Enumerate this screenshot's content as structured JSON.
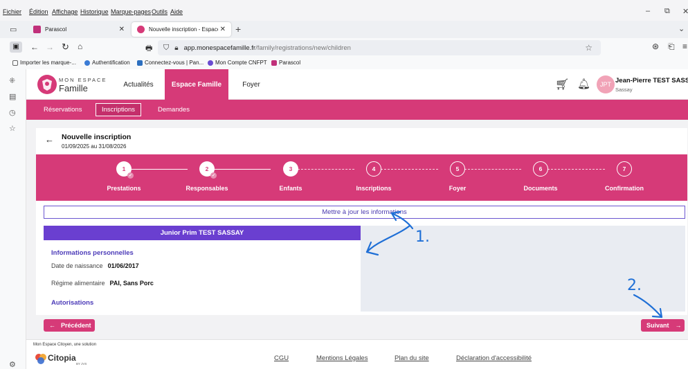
{
  "browser": {
    "menu": [
      "Fichier",
      "Édition",
      "Affichage",
      "Historique",
      "Marque-pages",
      "Outils",
      "Aide"
    ],
    "tabs": [
      {
        "label": "Parascol"
      },
      {
        "label": "Nouvelle inscription - Espace Fa"
      }
    ],
    "new_tab": "+",
    "url": {
      "host": "app.monespacefamille.fr",
      "path": "/family/registrations/new/children"
    },
    "bookmarks": [
      "Importer les marque-...",
      "Authentification",
      "Connectez-vous | Pan...",
      "Mon Compte CNFPT",
      "Parascol"
    ]
  },
  "app": {
    "logo": {
      "top": "MON ESPACE",
      "bottom": "Famille"
    },
    "nav": [
      "Actualités",
      "Espace Famille",
      "Foyer"
    ],
    "user": {
      "initials": "JPT",
      "name": "Jean-Pierre TEST SASSAY",
      "sub": "Sassay"
    },
    "subnav": [
      "Réservations",
      "Inscriptions",
      "Demandes"
    ],
    "page": {
      "title": "Nouvelle inscription",
      "period": "01/09/2025 au 31/08/2026"
    },
    "steps": [
      {
        "num": "1",
        "label": "Prestations",
        "state": "done"
      },
      {
        "num": "2",
        "label": "Responsables",
        "state": "done"
      },
      {
        "num": "3",
        "label": "Enfants",
        "state": "active"
      },
      {
        "num": "4",
        "label": "Inscriptions",
        "state": "todo"
      },
      {
        "num": "5",
        "label": "Foyer",
        "state": "todo"
      },
      {
        "num": "6",
        "label": "Documents",
        "state": "todo"
      },
      {
        "num": "7",
        "label": "Confirmation",
        "state": "todo"
      }
    ],
    "update_button": "Mettre à jour les informations",
    "child": {
      "name": "Junior Prim TEST SASSAY",
      "section_personal": "Informations personnelles",
      "birth_label": "Date de naissance",
      "birth_value": "01/06/2017",
      "diet_label": "Régime alimentaire",
      "diet_value": "PAI, Sans Porc",
      "section_auth": "Autorisations"
    },
    "prev_button": "Précédent",
    "next_button": "Suivant",
    "footer": {
      "credit": "Mon Espace Citoyen, une solution",
      "brand": "Citopia",
      "brand_sub": "BY JVS",
      "links": [
        "CGU",
        "Mentions Légales",
        "Plan du site",
        "Déclaration d'accessibilité"
      ]
    }
  },
  "annotations": {
    "mark1": "1.",
    "mark2": "2."
  },
  "colors": {
    "brand": "#d63a78",
    "accent": "#6a3fd0",
    "ink": "#1f6fd6"
  }
}
